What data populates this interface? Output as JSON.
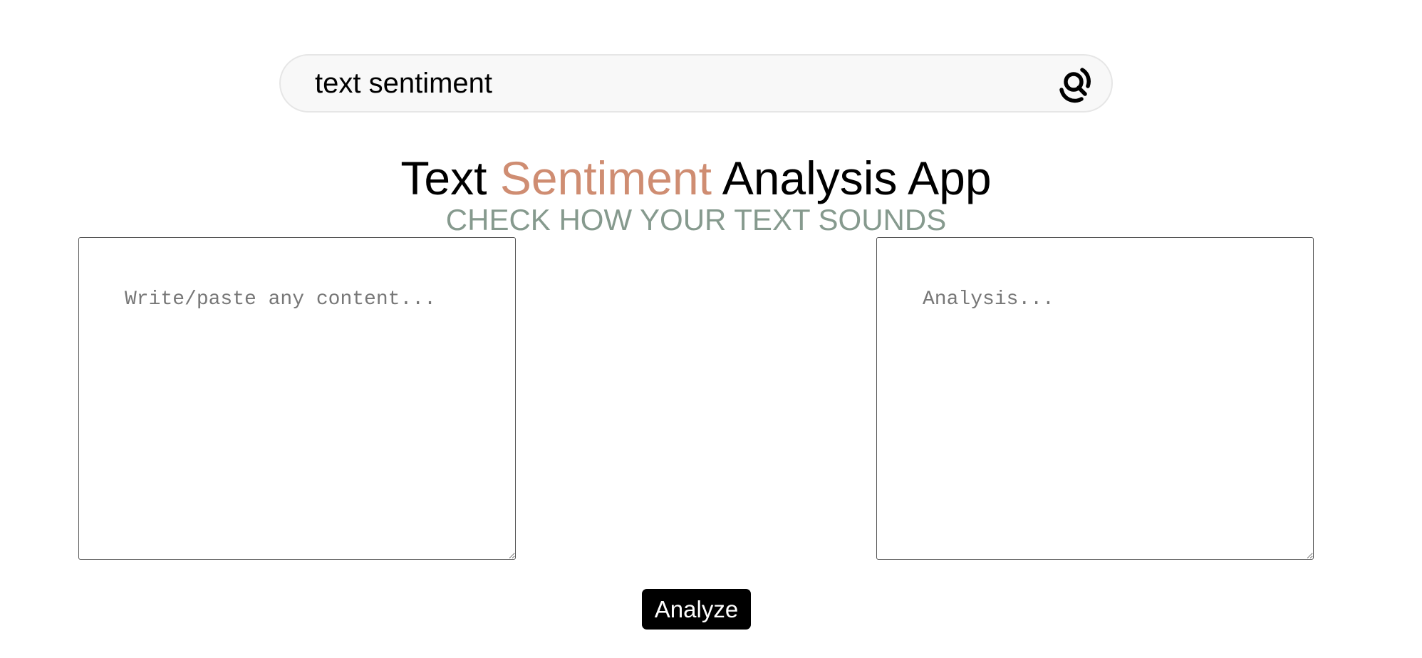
{
  "search": {
    "value": "text sentiment",
    "icon": "search-icon"
  },
  "header": {
    "title_part1": "Text",
    "title_accent": "Sentiment",
    "title_part2": "Analysis App",
    "subtitle": "CHECK HOW YOUR TEXT SOUNDS"
  },
  "input": {
    "placeholder": "Write/paste any content..."
  },
  "output": {
    "placeholder": "Analysis..."
  },
  "actions": {
    "analyze_label": "Analyze"
  },
  "colors": {
    "accent": "#cf8d72",
    "subtitle": "#869a8e",
    "button_bg": "#000000"
  }
}
